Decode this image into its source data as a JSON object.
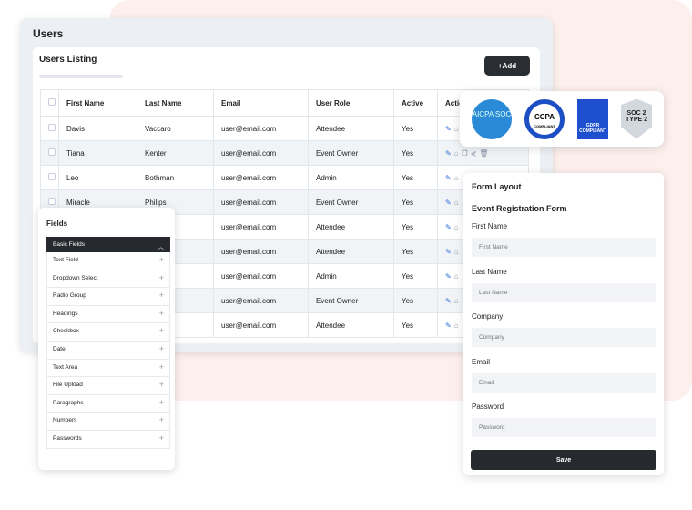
{
  "page": {
    "title": "Users"
  },
  "listing": {
    "title": "Users Listing",
    "add_label": "+Add",
    "columns": [
      "First Name",
      "Last Name",
      "Email",
      "User Role",
      "Active",
      "Actions"
    ],
    "rows": [
      {
        "first": "Davis",
        "last": "Vaccaro",
        "email": "user@email.com",
        "role": "Attendee",
        "active": "Yes"
      },
      {
        "first": "Tiana",
        "last": "Kenter",
        "email": "user@email.com",
        "role": "Event Owner",
        "active": "Yes"
      },
      {
        "first": "Leo",
        "last": "Bothman",
        "email": "user@email.com",
        "role": "Admin",
        "active": "Yes"
      },
      {
        "first": "Miracle",
        "last": "Philips",
        "email": "user@email.com",
        "role": "Event Owner",
        "active": "Yes"
      },
      {
        "first": "",
        "last": "",
        "email": "user@email.com",
        "role": "Attendee",
        "active": "Yes"
      },
      {
        "first": "",
        "last": "",
        "email": "user@email.com",
        "role": "Attendee",
        "active": "Yes"
      },
      {
        "first": "",
        "last": "",
        "email": "user@email.com",
        "role": "Admin",
        "active": "Yes"
      },
      {
        "first": "",
        "last": "",
        "email": "user@email.com",
        "role": "Event Owner",
        "active": "Yes"
      },
      {
        "first": "",
        "last": "",
        "email": "user@email.com",
        "role": "Attendee",
        "active": "Yes"
      }
    ]
  },
  "badges": {
    "aicpa": "AICPA SOC",
    "ccpa": "CCPA",
    "ccpa_sub": "COMPLIANT",
    "gdpr": "GDPR COMPLIANT",
    "soc2": "SOC 2 TYPE 2"
  },
  "fields": {
    "title": "Fields",
    "group": "Basic Fields",
    "items": [
      "Text Field",
      "Dropdown Select",
      "Radio Group",
      "Headings",
      "Checkbox",
      "Date",
      "Text Area",
      "File Upload",
      "Paragraphs",
      "Numbers",
      "Passwords"
    ]
  },
  "form": {
    "title": "Form Layout",
    "form_name": "Event Registration Form",
    "fields": [
      {
        "label": "First Name",
        "placeholder": "First Name"
      },
      {
        "label": "Last Name",
        "placeholder": "Last Name"
      },
      {
        "label": "Company",
        "placeholder": "Company"
      },
      {
        "label": "Email",
        "placeholder": "Email"
      },
      {
        "label": "Password",
        "placeholder": "Password"
      }
    ],
    "save_label": "Save"
  }
}
